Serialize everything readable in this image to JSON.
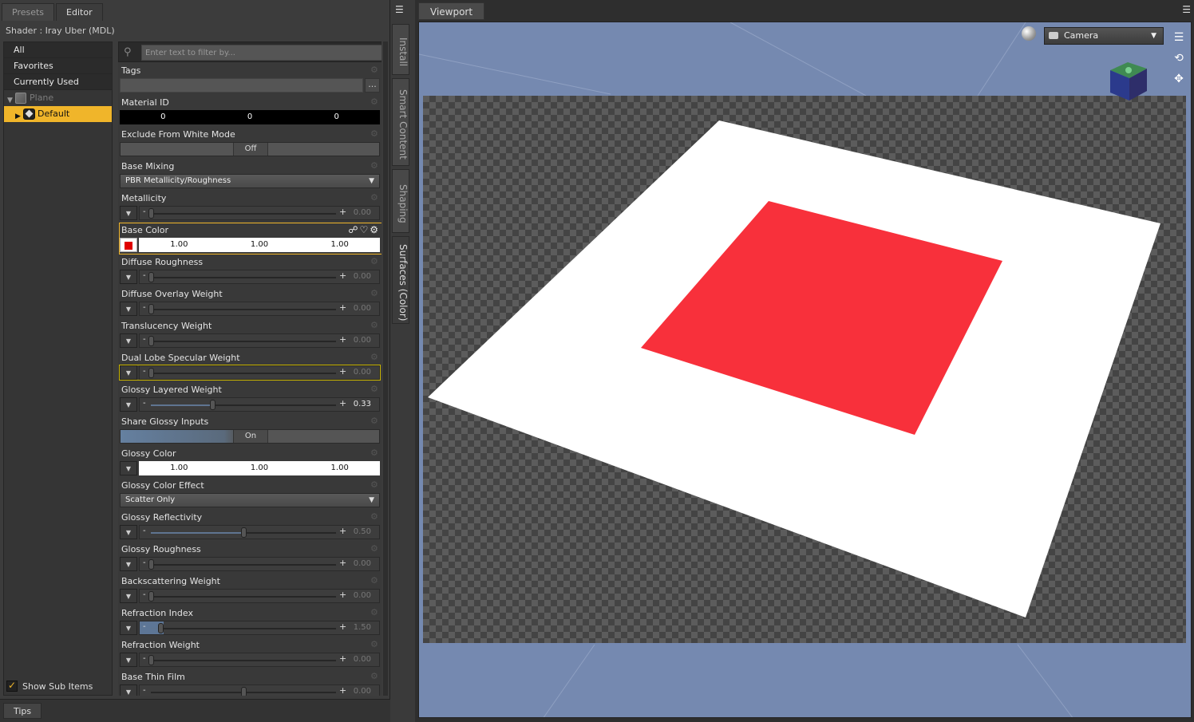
{
  "left_panel": {
    "tabs": [
      {
        "label": "Presets"
      },
      {
        "label": "Editor"
      }
    ],
    "shader_label": "Shader : Iray Uber (MDL)",
    "categories": [
      "All",
      "Favorites",
      "Currently Used"
    ],
    "tree": {
      "object": "Plane",
      "material": "Default"
    },
    "filter_placeholder": "Enter text to filter by...",
    "show_sub_items": "Show Sub Items",
    "tips_tab": "Tips"
  },
  "properties": {
    "tags": {
      "label": "Tags",
      "button": "..."
    },
    "material_id": {
      "label": "Material ID",
      "values": [
        "0",
        "0",
        "0"
      ]
    },
    "exclude_white": {
      "label": "Exclude From White Mode",
      "state": "Off"
    },
    "base_mixing": {
      "label": "Base Mixing",
      "value": "PBR Metallicity/Roughness"
    },
    "metallicity": {
      "label": "Metallicity",
      "value": "0.00",
      "fraction": 0
    },
    "base_color": {
      "label": "Base Color",
      "values": [
        "1.00",
        "1.00",
        "1.00"
      ],
      "swatch": "#e00000"
    },
    "diffuse_roughness": {
      "label": "Diffuse Roughness",
      "value": "0.00",
      "fraction": 0
    },
    "diffuse_overlay_weight": {
      "label": "Diffuse Overlay Weight",
      "value": "0.00",
      "fraction": 0
    },
    "translucency_weight": {
      "label": "Translucency Weight",
      "value": "0.00",
      "fraction": 0
    },
    "dual_lobe_specular_weight": {
      "label": "Dual Lobe Specular Weight",
      "value": "0.00",
      "fraction": 0
    },
    "glossy_layered_weight": {
      "label": "Glossy Layered Weight",
      "value": "0.33",
      "fraction": 0.33
    },
    "share_glossy_inputs": {
      "label": "Share Glossy Inputs",
      "state": "On"
    },
    "glossy_color": {
      "label": "Glossy Color",
      "values": [
        "1.00",
        "1.00",
        "1.00"
      ]
    },
    "glossy_color_effect": {
      "label": "Glossy Color Effect",
      "value": "Scatter Only"
    },
    "glossy_reflectivity": {
      "label": "Glossy Reflectivity",
      "value": "0.50",
      "fraction": 0.5
    },
    "glossy_roughness": {
      "label": "Glossy Roughness",
      "value": "0.00",
      "fraction": 0
    },
    "backscattering_weight": {
      "label": "Backscattering Weight",
      "value": "0.00",
      "fraction": 0
    },
    "refraction_index": {
      "label": "Refraction Index",
      "value": "1.50",
      "fraction": 0.05
    },
    "refraction_weight": {
      "label": "Refraction Weight",
      "value": "0.00",
      "fraction": 0
    },
    "base_thin_film": {
      "label": "Base Thin Film",
      "value": "0.00",
      "fraction": 0.5
    }
  },
  "side_tabs": [
    "Install",
    "Smart Content",
    "Shaping",
    "Surfaces (Color)"
  ],
  "viewport": {
    "tab": "Viewport",
    "camera": "Camera",
    "colors": {
      "background": "#7589b0",
      "plane": "#ffffff",
      "square": "#f8303b"
    }
  }
}
